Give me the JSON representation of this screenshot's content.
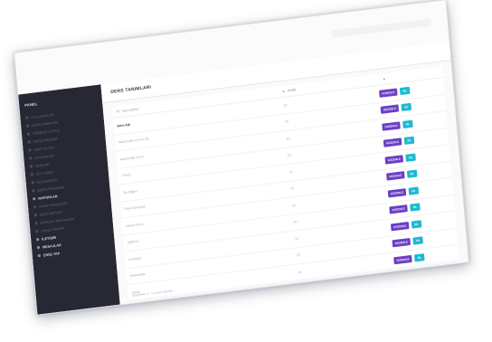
{
  "page": {
    "title": "DERS TANIMLARI"
  },
  "sidebar": {
    "brand": "PANEL",
    "items": [
      {
        "label": "KULLANICILAR",
        "group": false
      },
      {
        "label": "DERS TANIMLARI",
        "group": false
      },
      {
        "label": "ÖĞRENCİ LİSTESİ",
        "group": false
      },
      {
        "label": "ÖĞRETMENLER",
        "group": false
      },
      {
        "label": "SINIF LİSTESİ",
        "group": false
      },
      {
        "label": "DUYURULAR",
        "group": false
      },
      {
        "label": "AYARLAR",
        "group": false
      },
      {
        "label": "NOT GİRİŞİ",
        "group": false
      },
      {
        "label": "DEVAMSIZLIK",
        "group": false
      },
      {
        "label": "DERS PROGRAMI",
        "group": false
      },
      {
        "label": "RAPORLAR",
        "group": true
      },
      {
        "label": "SINAV SONUÇLARI",
        "group": false
      },
      {
        "label": "DERS RAPORU",
        "group": false
      },
      {
        "label": "ÖĞRENCİ RAPORLARI",
        "group": false
      },
      {
        "label": "GENEL RAPOR",
        "group": false
      },
      {
        "label": "İLETİŞİM",
        "group": true
      },
      {
        "label": "MESAJLAR",
        "group": true
      },
      {
        "label": "ÇIKIŞ YAP",
        "group": true
      }
    ]
  },
  "table": {
    "length_label": "10",
    "length_suffix": "kayıt göster",
    "columns": {
      "name": "Ders Adı",
      "credit": "Kredi",
      "actions": ""
    },
    "rows": [
      {
        "name": "Ders Adı",
        "credit": "10"
      },
      {
        "name": "Matematik ve Fen Tb",
        "credit": "10"
      },
      {
        "name": "Matematik Dersi",
        "credit": "10"
      },
      {
        "name": "Türkçe",
        "credit": "10"
      },
      {
        "name": "Din Bilgisi",
        "credit": "10"
      },
      {
        "name": "Fizik Deneyleri",
        "credit": "10"
      },
      {
        "name": "Kimya Dersi",
        "credit": "10"
      },
      {
        "name": "İngilizce",
        "credit": "10"
      },
      {
        "name": "Edebiyat",
        "credit": "10"
      },
      {
        "name": "Matematik",
        "credit": "10"
      },
      {
        "name": "Ahlak",
        "credit": "10"
      }
    ],
    "edit_label": "DÜZENLE",
    "delete_label": "SİL",
    "footer": "Gösterilen 1 - 11 arası kayıtlar"
  }
}
